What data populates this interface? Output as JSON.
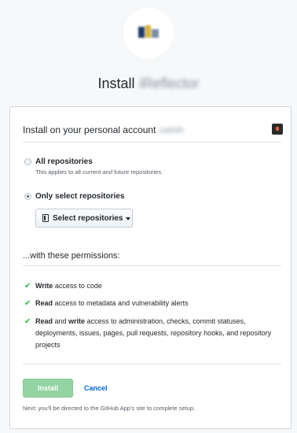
{
  "header": {
    "title": "Install",
    "app_name": "iReflector"
  },
  "account": {
    "label": "Install on your personal account",
    "username": "satish"
  },
  "repositories": {
    "all_label": "All repositories",
    "all_note_before": "This applies to all current ",
    "all_note_em": "and",
    "all_note_after": " future repositories.",
    "only_label": "Only select repositories",
    "select_button": "Select repositories",
    "selected_option": "only"
  },
  "permissions": {
    "heading": "...with these permissions:",
    "items": [
      {
        "strong": "Write",
        "text": " access to code"
      },
      {
        "strong": "Read",
        "text": " access to metadata and vulnerability alerts"
      },
      {
        "strong": "Read",
        "mid": " and ",
        "strong2": "write",
        "text": " access to administration, checks, commit statuses, deployments, issues, pages, pull requests, repository hooks, and repository projects"
      }
    ]
  },
  "actions": {
    "install_label": "Install",
    "cancel_label": "Cancel",
    "next_note": "Next: you'll be directed to the GitHub App's site to complete setup."
  },
  "colors": {
    "success": "#2cbe4e",
    "link": "#0366d6",
    "install_button_disabled": "#94d3a2"
  },
  "icons": [
    "app-logo-icon",
    "account-avatar-icon",
    "repo-icon",
    "chevron-down-icon",
    "check-icon"
  ]
}
